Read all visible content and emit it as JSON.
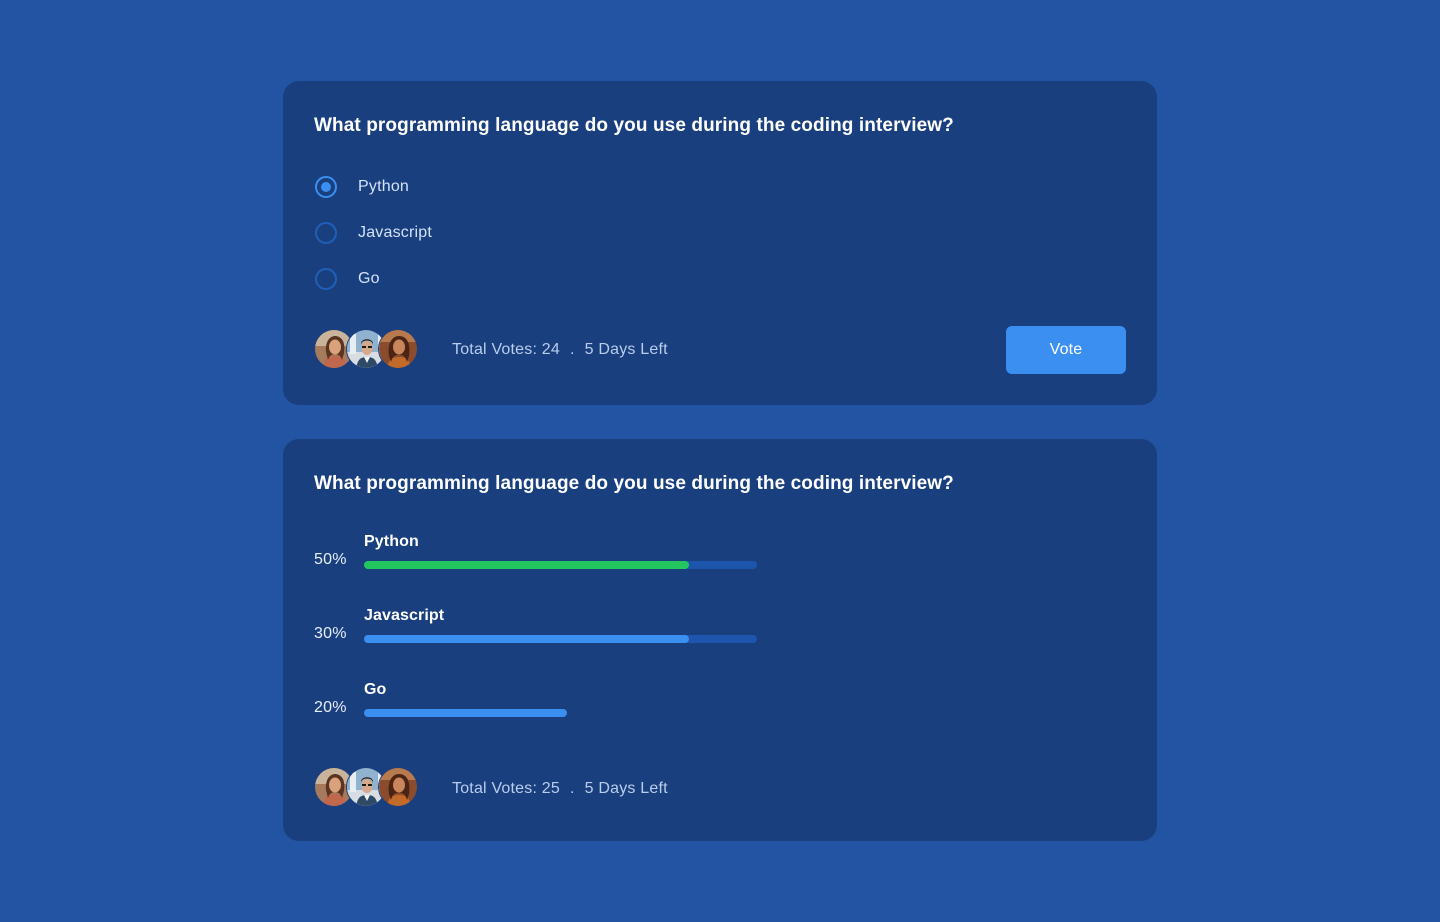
{
  "colors": {
    "page_background": "#2254a3",
    "card_background": "#1a3f7f",
    "accent": "#3a8ff0",
    "winner": "#22c55e",
    "track": "#1e55ac"
  },
  "vote_poll": {
    "question": "What programming language do you use during the coding interview?",
    "options": [
      {
        "label": "Python",
        "selected": true
      },
      {
        "label": "Javascript",
        "selected": false
      },
      {
        "label": "Go",
        "selected": false
      }
    ],
    "total_votes": "Total Votes: 24",
    "separator": ".",
    "time_left": "5 Days Left",
    "vote_button_label": "Vote",
    "avatars": [
      "avatar-woman-1",
      "avatar-man",
      "avatar-woman-2"
    ]
  },
  "result_poll": {
    "question": "What programming language do you use during the coding interview?",
    "results": [
      {
        "label": "Python",
        "percent_label": "50%",
        "bar_fill": 0.827,
        "show_track": true,
        "leading": true
      },
      {
        "label": "Javascript",
        "percent_label": "30%",
        "bar_fill": 0.827,
        "show_track": true,
        "leading": false
      },
      {
        "label": "Go",
        "percent_label": "20%",
        "bar_fill": 0.517,
        "show_track": false,
        "leading": false
      }
    ],
    "total_votes": "Total Votes: 25",
    "separator": ".",
    "time_left": "5 Days Left",
    "avatars": [
      "avatar-woman-1",
      "avatar-man",
      "avatar-woman-2"
    ]
  }
}
